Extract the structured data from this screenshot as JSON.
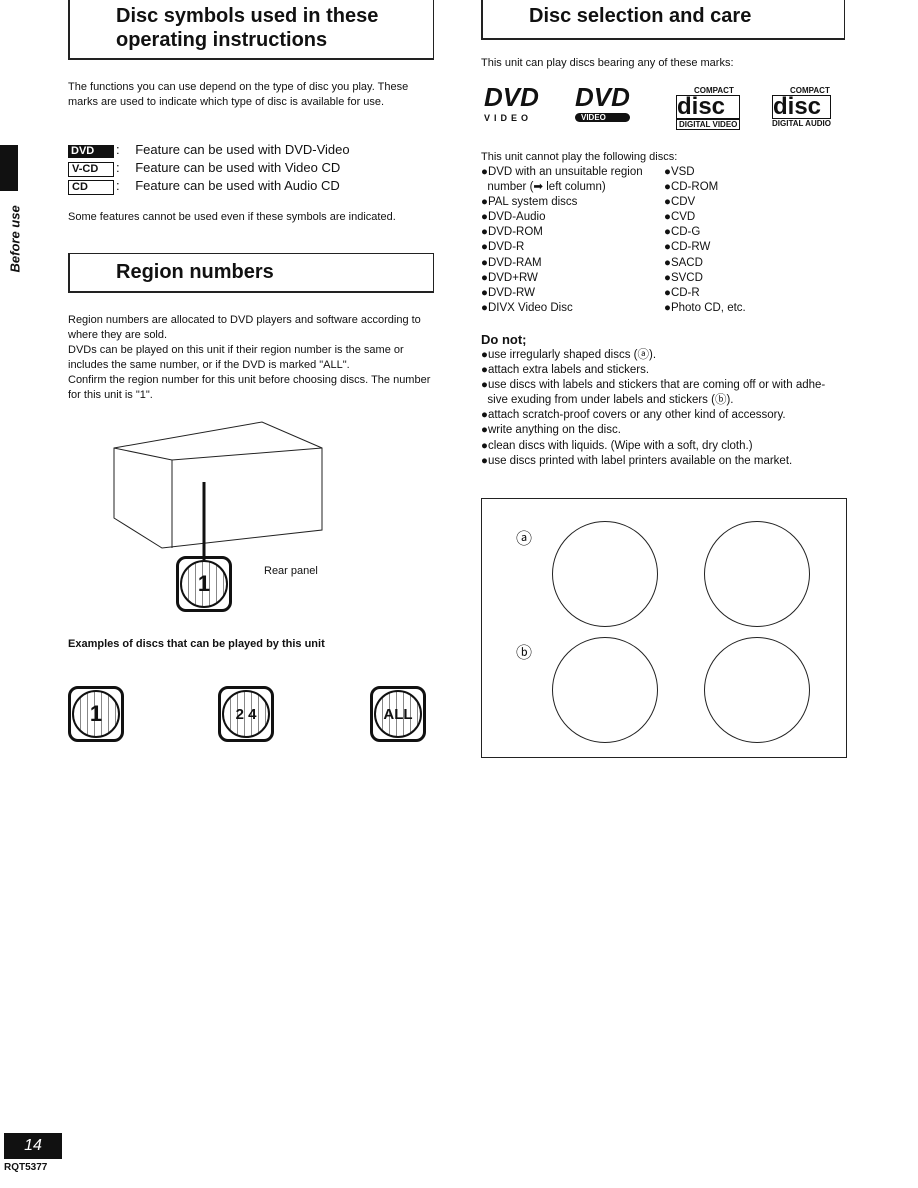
{
  "left": {
    "title1": "Disc symbols used in these operating instructions",
    "intro": "The functions you can use depend on the type of disc you play. These marks are used to indicate which type of disc is available for use.",
    "symbols": [
      {
        "mark": "DVD",
        "text": "Feature can be used with DVD-Video"
      },
      {
        "mark": "V-CD",
        "text": "Feature can be used with Video CD"
      },
      {
        "mark": "CD",
        "text": "Feature can be used with Audio CD"
      }
    ],
    "note": "Some features cannot be used even if these symbols are indicated.",
    "title2": "Region numbers",
    "region_text": "Region numbers are allocated to DVD players and software according to where they are sold.\nDVDs can be played on this unit if their region number is the same or includes the same number, or if the DVD is marked \"ALL\".\nConfirm the region number for this unit before choosing discs. The number for this unit is \"1\".",
    "rear_panel": "Rear panel",
    "unit_region": "1",
    "examples_caption": "Examples of discs that can be played by this unit",
    "examples": [
      "1",
      "2 4",
      "ALL"
    ]
  },
  "side_tab": "Before use",
  "right": {
    "title": "Disc selection and care",
    "can_play": "This unit can play discs bearing any of these marks:",
    "logos": [
      {
        "main": "DVD",
        "sub": "VIDEO"
      },
      {
        "main": "DVD",
        "sub": "VIDEO"
      },
      {
        "main": "disc",
        "top": "COMPACT",
        "sub": "DIGITAL VIDEO"
      },
      {
        "main": "disc",
        "top": "COMPACT",
        "sub": "DIGITAL AUDIO"
      }
    ],
    "cannot_play": "This unit cannot play the following discs:",
    "col1": [
      "●DVD with an unsuitable region",
      "  number (➡ left column)",
      "●PAL system discs",
      "●DVD-Audio",
      "●DVD-ROM",
      "●DVD-R",
      "●DVD-RAM",
      "●DVD+RW",
      "●DVD-RW",
      "●DIVX Video Disc"
    ],
    "col2": [
      "●VSD",
      "●CD-ROM",
      "●CDV",
      "●CVD",
      "●CD-G",
      "●CD-RW",
      "●SACD",
      "●SVCD",
      "●CD-R",
      "●Photo CD, etc."
    ],
    "donot_title": "Do not;",
    "donot": [
      "●use irregularly shaped discs (ⓐ).",
      "●attach extra labels and stickers.",
      "●use discs with labels and stickers that are coming off or with adhe-",
      "  sive exuding from under labels and stickers (ⓑ).",
      "●attach scratch-proof covers or any other kind of accessory.",
      "●write anything on the disc.",
      "●clean discs with liquids. (Wipe with a soft, dry cloth.)",
      "●use discs printed with label printers available on the market."
    ],
    "label_a": "ⓐ",
    "label_b": "ⓑ"
  },
  "footer": {
    "page": "14",
    "code": "RQT5377"
  }
}
